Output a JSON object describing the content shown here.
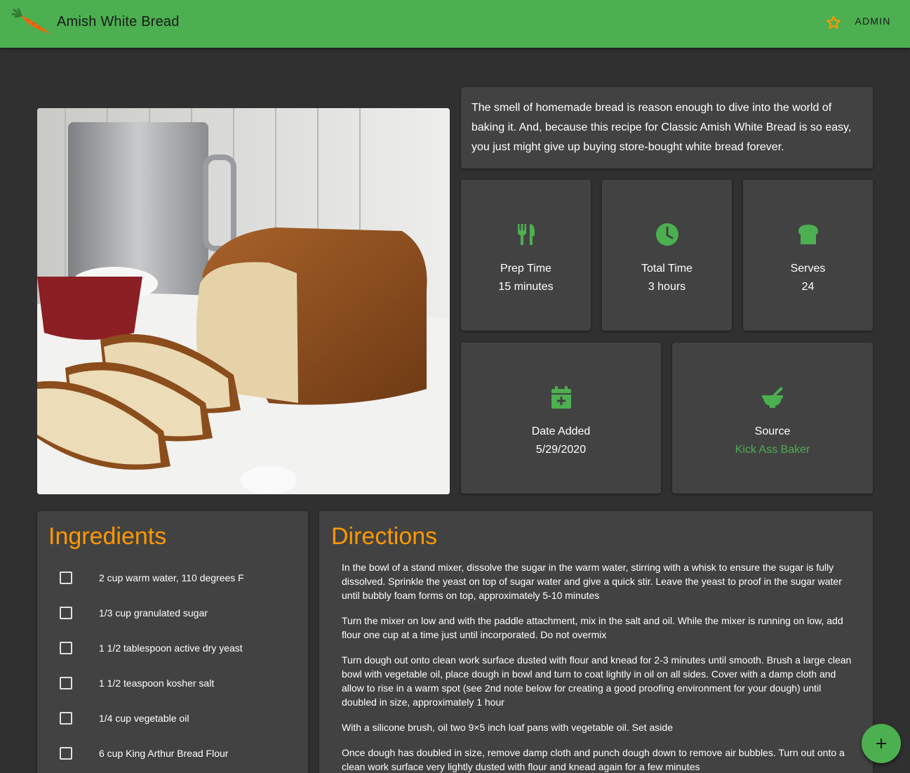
{
  "header": {
    "title": "Amish White Bread",
    "user_label": "ADMIN",
    "icons": {
      "logo": "carrot-logo",
      "favorite": "star-outline-icon"
    }
  },
  "recipe": {
    "description": "The smell of homemade bread is reason enough to dive into the world of baking it. And, because this recipe for Classic Amish White Bread is so easy, you just might give up buying store-bought white bread forever.",
    "stats": {
      "prep": {
        "label": "Prep Time",
        "value": "15 minutes",
        "icon": "utensils-icon"
      },
      "total": {
        "label": "Total Time",
        "value": "3 hours",
        "icon": "clock-icon"
      },
      "serves": {
        "label": "Serves",
        "value": "24",
        "icon": "bread-icon"
      },
      "date": {
        "label": "Date Added",
        "value": "5/29/2020",
        "icon": "calendar-plus-icon"
      },
      "source": {
        "label": "Source",
        "value": "Kick Ass Baker",
        "icon": "mortar-pestle-icon"
      }
    }
  },
  "ingredients": {
    "title": "Ingredients",
    "items": [
      {
        "text": "2 cup warm water, 110 degrees F",
        "checked": false
      },
      {
        "text": "1/3 cup granulated sugar",
        "checked": false
      },
      {
        "text": "1 1/2 tablespoon active dry yeast",
        "checked": false
      },
      {
        "text": "1 1/2 teaspoon kosher salt",
        "checked": false
      },
      {
        "text": "1/4 cup vegetable oil",
        "checked": false
      },
      {
        "text": "6 cup King Arthur Bread Flour",
        "checked": false
      }
    ]
  },
  "directions": {
    "title": "Directions",
    "steps": [
      "In the bowl of a stand mixer, dissolve the sugar in the warm water, stirring with a whisk to ensure the sugar is fully dissolved. Sprinkle the yeast on top of sugar water and give a quick stir. Leave the yeast to proof in the sugar water until bubbly foam forms on top, approximately 5-10 minutes",
      "Turn the mixer on low and with the paddle attachment, mix in the salt and oil. While the mixer is running on low, add flour one cup at a time just until incorporated. Do not overmix",
      "Turn dough out onto clean work surface dusted with flour and knead for 2-3 minutes until smooth. Brush a large clean bowl with vegetable oil, place dough in bowl and turn to coat lightly in oil on all sides. Cover with a damp cloth and allow to rise in a warm spot (see 2nd note below for creating a good proofing environment for your dough) until doubled in size, approximately 1 hour",
      "With a silicone brush, oil two 9×5 inch loaf pans with vegetable oil. Set aside",
      "Once dough has doubled in size, remove damp cloth and punch dough down to remove air bubbles. Turn out onto a clean work surface very lightly dusted with flour and knead again for a few minutes"
    ]
  },
  "fab": {
    "icon": "plus-icon"
  },
  "colors": {
    "primary": "#4caf50",
    "accent": "#ff9800",
    "background": "#303030",
    "card": "#424242"
  }
}
